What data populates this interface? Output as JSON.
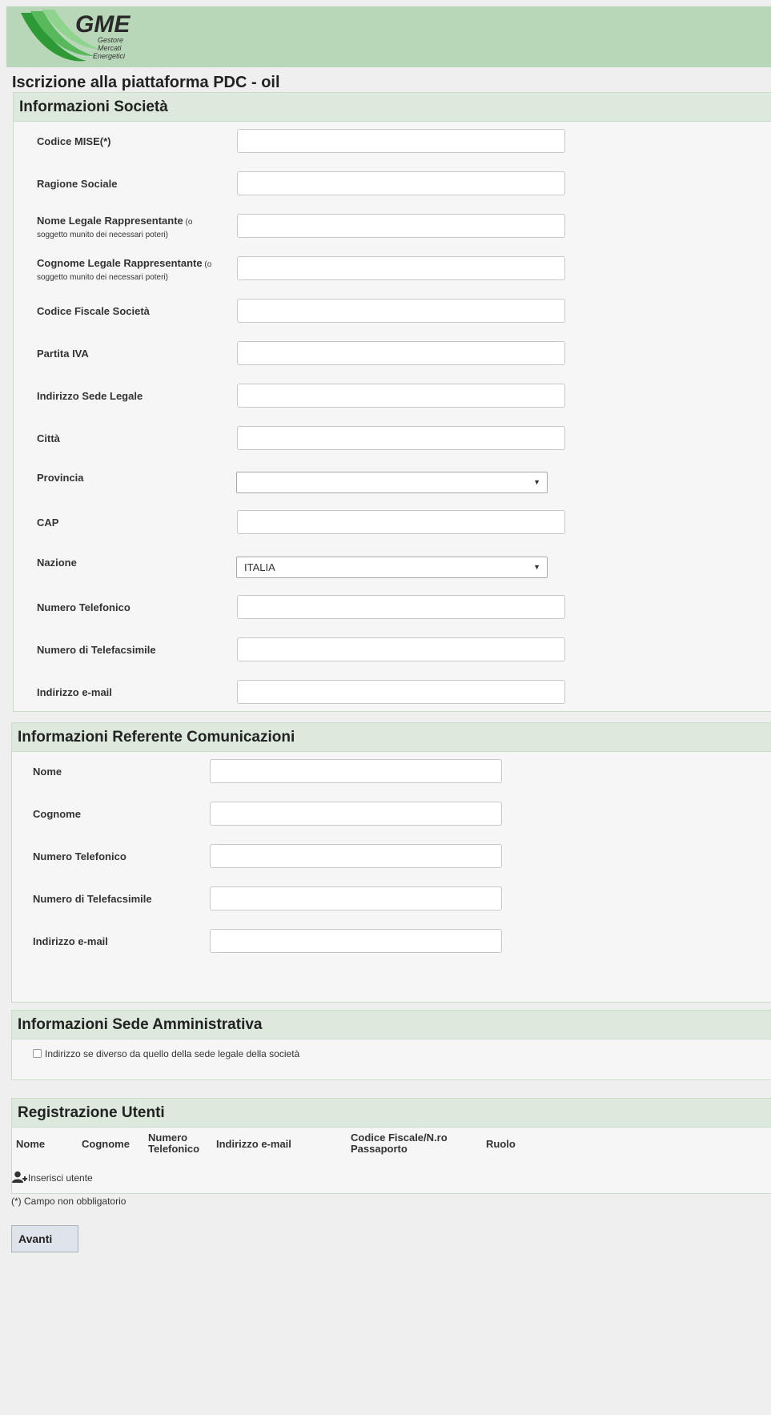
{
  "header": {
    "logo_text": "GME",
    "logo_subtext": [
      "Gestore",
      "Mercati",
      "Energetici"
    ]
  },
  "page": {
    "title": "Iscrizione alla piattaforma PDC - oil"
  },
  "company_section": {
    "title": "Informazioni Società",
    "fields": {
      "codice_mise": {
        "label": "Codice MISE(*)",
        "value": ""
      },
      "ragione_sociale": {
        "label": "Ragione Sociale",
        "value": ""
      },
      "nome_legale": {
        "label": "Nome Legale Rappresentante",
        "sub_a": " (o",
        "sub_b": "soggetto munito dei necessari poteri)",
        "value": ""
      },
      "cognome_legale": {
        "label": "Cognome Legale Rappresentante",
        "sub_a": " (o",
        "sub_b": "soggetto munito dei necessari poteri)",
        "value": ""
      },
      "codice_fiscale": {
        "label": "Codice Fiscale Società",
        "value": ""
      },
      "partita_iva": {
        "label": "Partita IVA",
        "value": ""
      },
      "indirizzo_sede": {
        "label": "Indirizzo Sede Legale",
        "value": ""
      },
      "citta": {
        "label": "Città",
        "value": ""
      },
      "provincia": {
        "label": "Provincia",
        "selected": ""
      },
      "cap": {
        "label": "CAP",
        "value": ""
      },
      "nazione": {
        "label": "Nazione",
        "selected": "ITALIA"
      },
      "telefono": {
        "label": "Numero Telefonico",
        "value": ""
      },
      "fax": {
        "label": "Numero di Telefacsimile",
        "value": ""
      },
      "email": {
        "label": "Indirizzo e-mail",
        "value": ""
      }
    }
  },
  "contact_section": {
    "title": "Informazioni Referente Comunicazioni",
    "fields": {
      "nome": {
        "label": "Nome",
        "value": ""
      },
      "cognome": {
        "label": "Cognome",
        "value": ""
      },
      "telefono": {
        "label": "Numero Telefonico",
        "value": ""
      },
      "fax": {
        "label": "Numero di Telefacsimile",
        "value": ""
      },
      "email": {
        "label": "Indirizzo e-mail",
        "value": ""
      }
    }
  },
  "admin_section": {
    "title": "Informazioni Sede Amministrativa",
    "checkbox_label": "Indirizzo se diverso da quello della sede legale della società",
    "checked": false
  },
  "users_section": {
    "title": "Registrazione Utenti",
    "columns": {
      "nome": "Nome",
      "cognome": "Cognome",
      "telefono_1": "Numero",
      "telefono_2": "Telefonico",
      "email": "Indirizzo e-mail",
      "cf_1": "Codice Fiscale/N.ro",
      "cf_2": "Passaporto",
      "ruolo": "Ruolo"
    },
    "add_user_label": "Inserisci utente"
  },
  "footer": {
    "note": "(*) Campo non obbligatorio",
    "next_button": "Avanti"
  },
  "colors": {
    "header_bg": "#b8d6b8",
    "section_head_bg": "#dce9dc",
    "logo_green": "#2e9a35"
  }
}
